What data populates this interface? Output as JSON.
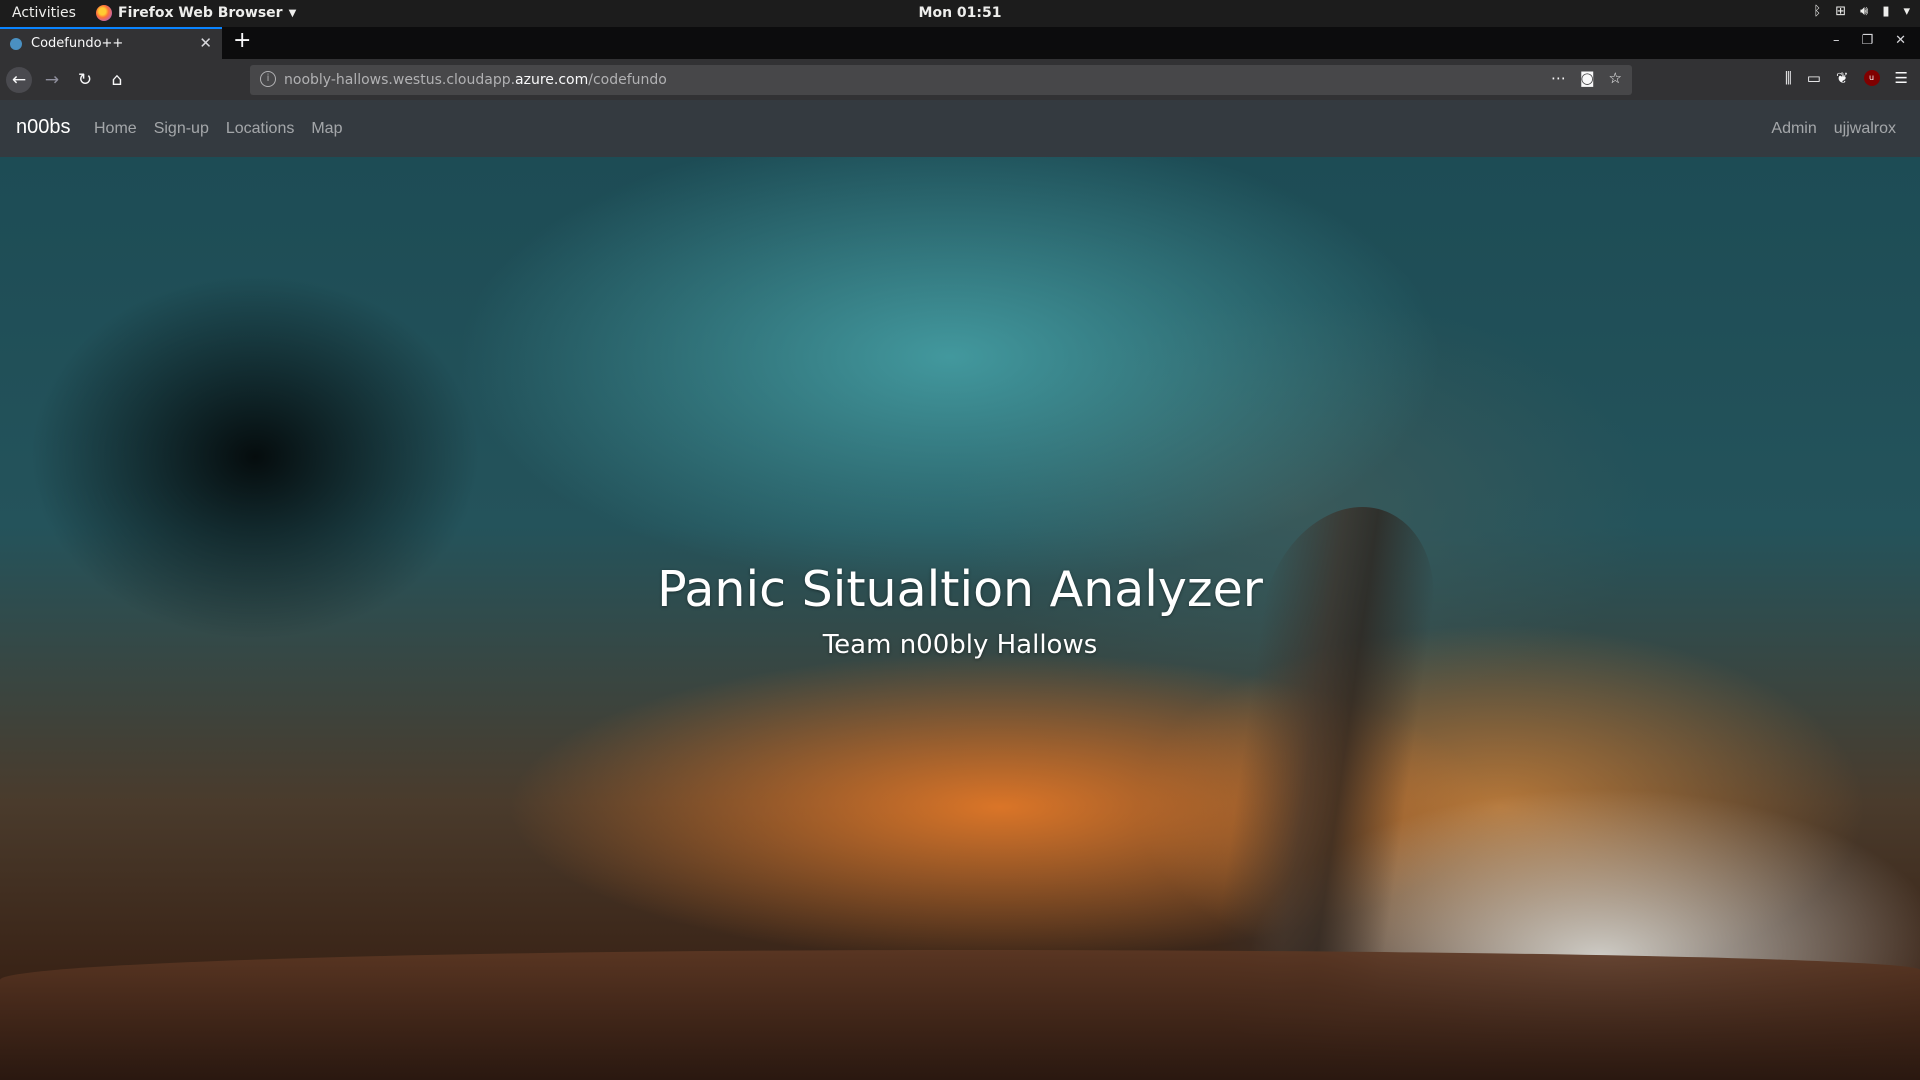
{
  "system_bar": {
    "activities": "Activities",
    "app_name": "Firefox Web Browser",
    "clock": "Mon 01:51"
  },
  "browser": {
    "tab_title": "Codefundo++",
    "url_prefix": "noobly-hallows.westus.cloudapp.",
    "url_host": "azure.com",
    "url_path": "/codefundo",
    "accent": "#0a84ff"
  },
  "site": {
    "brand": "n00bs",
    "nav_links": [
      "Home",
      "Sign-up",
      "Locations",
      "Map"
    ],
    "nav_right": [
      "Admin",
      "ujjwalrox"
    ],
    "navbar_color": "#343a40"
  },
  "hero": {
    "title": "Panic Situaltion Analyzer",
    "subtitle": "Team n00bly Hallows"
  }
}
